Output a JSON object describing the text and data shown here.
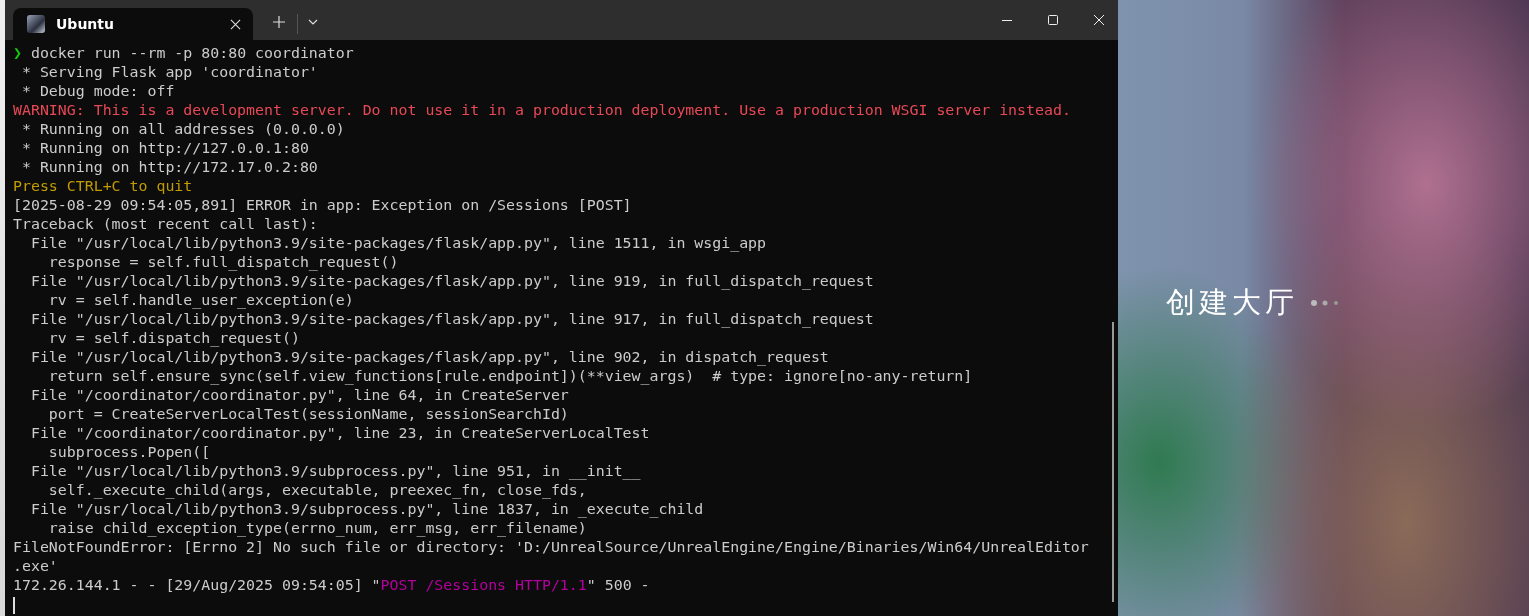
{
  "window": {
    "tabs": [
      {
        "title": "Ubuntu",
        "selected": true
      }
    ]
  },
  "terminal": {
    "lines": [
      [
        {
          "kind": "prompt",
          "text": "❯"
        },
        {
          "kind": "plain",
          "text": " docker run --rm -p 80:80 coordinator"
        }
      ],
      [
        {
          "kind": "plain",
          "text": " * Serving Flask app 'coordinator'"
        }
      ],
      [
        {
          "kind": "plain",
          "text": " * Debug mode: off"
        }
      ],
      [
        {
          "kind": "warning",
          "text": "WARNING: This is a development server. Do not use it in a production deployment. Use a production WSGI server instead."
        }
      ],
      [
        {
          "kind": "plain",
          "text": " * Running on all addresses (0.0.0.0)"
        }
      ],
      [
        {
          "kind": "plain",
          "text": " * Running on http://127.0.0.1:80"
        }
      ],
      [
        {
          "kind": "plain",
          "text": " * Running on http://172.17.0.2:80"
        }
      ],
      [
        {
          "kind": "notice",
          "text": "Press CTRL+C to quit"
        }
      ],
      [
        {
          "kind": "plain",
          "text": "[2025-08-29 09:54:05,891] ERROR in app: Exception on /Sessions [POST]"
        }
      ],
      [
        {
          "kind": "plain",
          "text": "Traceback (most recent call last):"
        }
      ],
      [
        {
          "kind": "plain",
          "text": "  File \"/usr/local/lib/python3.9/site-packages/flask/app.py\", line 1511, in wsgi_app"
        }
      ],
      [
        {
          "kind": "plain",
          "text": "    response = self.full_dispatch_request()"
        }
      ],
      [
        {
          "kind": "plain",
          "text": "  File \"/usr/local/lib/python3.9/site-packages/flask/app.py\", line 919, in full_dispatch_request"
        }
      ],
      [
        {
          "kind": "plain",
          "text": "    rv = self.handle_user_exception(e)"
        }
      ],
      [
        {
          "kind": "plain",
          "text": "  File \"/usr/local/lib/python3.9/site-packages/flask/app.py\", line 917, in full_dispatch_request"
        }
      ],
      [
        {
          "kind": "plain",
          "text": "    rv = self.dispatch_request()"
        }
      ],
      [
        {
          "kind": "plain",
          "text": "  File \"/usr/local/lib/python3.9/site-packages/flask/app.py\", line 902, in dispatch_request"
        }
      ],
      [
        {
          "kind": "plain",
          "text": "    return self.ensure_sync(self.view_functions[rule.endpoint])(**view_args)  # type: ignore[no-any-return]"
        }
      ],
      [
        {
          "kind": "plain",
          "text": "  File \"/coordinator/coordinator.py\", line 64, in CreateServer"
        }
      ],
      [
        {
          "kind": "plain",
          "text": "    port = CreateServerLocalTest(sessionName, sessionSearchId)"
        }
      ],
      [
        {
          "kind": "plain",
          "text": "  File \"/coordinator/coordinator.py\", line 23, in CreateServerLocalTest"
        }
      ],
      [
        {
          "kind": "plain",
          "text": "    subprocess.Popen(["
        }
      ],
      [
        {
          "kind": "plain",
          "text": "  File \"/usr/local/lib/python3.9/subprocess.py\", line 951, in __init__"
        }
      ],
      [
        {
          "kind": "plain",
          "text": "    self._execute_child(args, executable, preexec_fn, close_fds,"
        }
      ],
      [
        {
          "kind": "plain",
          "text": "  File \"/usr/local/lib/python3.9/subprocess.py\", line 1837, in _execute_child"
        }
      ],
      [
        {
          "kind": "plain",
          "text": "    raise child_exception_type(errno_num, err_msg, err_filename)"
        }
      ],
      [
        {
          "kind": "plain",
          "text": "FileNotFoundError: [Errno 2] No such file or directory: 'D:/UnrealSource/UnrealEngine/Engine/Binaries/Win64/UnrealEditor"
        }
      ],
      [
        {
          "kind": "plain",
          "text": ".exe'"
        }
      ],
      [
        {
          "kind": "plain",
          "text": "172.26.144.1 - - [29/Aug/2025 09:54:05] \""
        },
        {
          "kind": "request",
          "text": "POST /Sessions HTTP/1.1"
        },
        {
          "kind": "plain",
          "text": "\" 500 -"
        }
      ]
    ]
  },
  "game_view": {
    "status": "创建大厅"
  }
}
